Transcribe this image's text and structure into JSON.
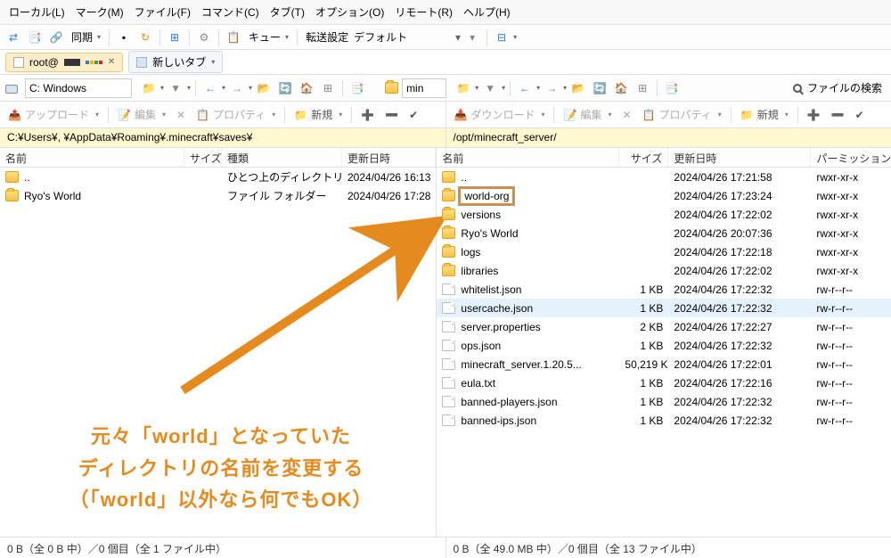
{
  "menu": {
    "items": [
      "ローカル(L)",
      "マーク(M)",
      "ファイル(F)",
      "コマンド(C)",
      "タブ(T)",
      "オプション(O)",
      "リモート(R)",
      "ヘルプ(H)"
    ]
  },
  "toolbar1": {
    "sync": "同期",
    "queue": "キュー",
    "transfer_setting": "転送設定",
    "default": "デフォルト"
  },
  "tabs": {
    "session": "root@",
    "newtab": "新しいタブ"
  },
  "nav": {
    "local_drive": "C: Windows",
    "remote_dir": "min",
    "search": "ファイルの検索"
  },
  "ops": {
    "upload": "アップロード",
    "download": "ダウンロード",
    "edit": "編集",
    "properties": "プロパティ",
    "new": "新規"
  },
  "paths": {
    "left": "C:¥Users¥,      ¥AppData¥Roaming¥.minecraft¥saves¥",
    "right": "/opt/minecraft_server/"
  },
  "headers": {
    "name": "名前",
    "size": "サイズ",
    "kind": "種類",
    "date": "更新日時",
    "perm": "パーミッション"
  },
  "left_rows": [
    {
      "name": "..",
      "icon": "up",
      "size": "",
      "kind": "ひとつ上のディレクトリ",
      "date": "2024/04/26 16:13"
    },
    {
      "name": "Ryo's World",
      "icon": "folder",
      "size": "",
      "kind": "ファイル フォルダー",
      "date": "2024/04/26 17:28"
    }
  ],
  "rename_value": "world-org",
  "right_rows": [
    {
      "name": "..",
      "icon": "up",
      "size": "",
      "date": "2024/04/26 17:21:58",
      "perm": "rwxr-xr-x",
      "rename": false
    },
    {
      "name": "world-org",
      "icon": "folder",
      "size": "",
      "date": "2024/04/26 17:23:24",
      "perm": "rwxr-xr-x",
      "rename": true
    },
    {
      "name": "versions",
      "icon": "folder",
      "size": "",
      "date": "2024/04/26 17:22:02",
      "perm": "rwxr-xr-x"
    },
    {
      "name": "Ryo's World",
      "icon": "folder",
      "size": "",
      "date": "2024/04/26 20:07:36",
      "perm": "rwxr-xr-x"
    },
    {
      "name": "logs",
      "icon": "folder",
      "size": "",
      "date": "2024/04/26 17:22:18",
      "perm": "rwxr-xr-x"
    },
    {
      "name": "libraries",
      "icon": "folder",
      "size": "",
      "date": "2024/04/26 17:22:02",
      "perm": "rwxr-xr-x"
    },
    {
      "name": "whitelist.json",
      "icon": "file",
      "size": "1 KB",
      "date": "2024/04/26 17:22:32",
      "perm": "rw-r--r--"
    },
    {
      "name": "usercache.json",
      "icon": "file",
      "size": "1 KB",
      "date": "2024/04/26 17:22:32",
      "perm": "rw-r--r--",
      "sel": true
    },
    {
      "name": "server.properties",
      "icon": "file",
      "size": "2 KB",
      "date": "2024/04/26 17:22:27",
      "perm": "rw-r--r--"
    },
    {
      "name": "ops.json",
      "icon": "file",
      "size": "1 KB",
      "date": "2024/04/26 17:22:32",
      "perm": "rw-r--r--"
    },
    {
      "name": "minecraft_server.1.20.5...",
      "icon": "file",
      "size": "50,219 KB",
      "date": "2024/04/26 17:22:01",
      "perm": "rw-r--r--"
    },
    {
      "name": "eula.txt",
      "icon": "file",
      "size": "1 KB",
      "date": "2024/04/26 17:22:16",
      "perm": "rw-r--r--"
    },
    {
      "name": "banned-players.json",
      "icon": "file",
      "size": "1 KB",
      "date": "2024/04/26 17:22:32",
      "perm": "rw-r--r--"
    },
    {
      "name": "banned-ips.json",
      "icon": "file",
      "size": "1 KB",
      "date": "2024/04/26 17:22:32",
      "perm": "rw-r--r--"
    }
  ],
  "status": {
    "left": "0 B（全 0 B 中）／0 個目（全 1 ファイル中）",
    "right": "0 B（全 49.0 MB 中）／0 個目（全 13 ファイル中）"
  },
  "annotation": {
    "line1": "元々「world」となっていた",
    "line2": "ディレクトリの名前を変更する",
    "line3": "（「world」以外なら何でもOK）"
  }
}
